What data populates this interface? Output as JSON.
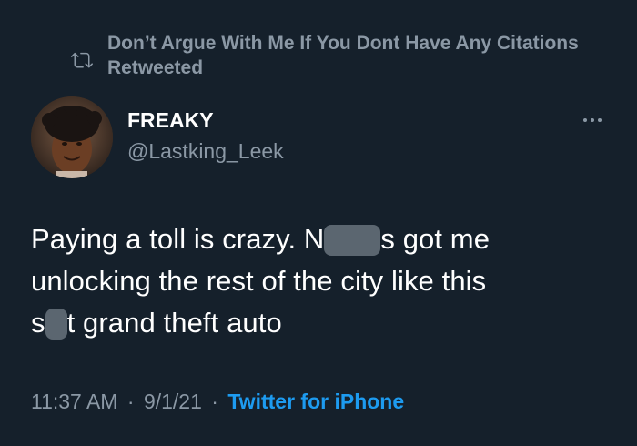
{
  "retweet": {
    "text": "Don’t Argue With Me If You Dont Have Any Citations Retweeted",
    "icon": "retweet-icon"
  },
  "author": {
    "display_name": "FREAKY",
    "handle": "@Lastking_Leek"
  },
  "tweet": {
    "line1_before": "Paying a toll is crazy. N",
    "line1_after": "s got me",
    "line2": "unlocking the rest of the city like this",
    "line3_before": "s",
    "line3_after": "t grand theft auto"
  },
  "meta": {
    "time": "11:37 AM",
    "separator": "·",
    "date": "9/1/21",
    "source": "Twitter for iPhone"
  },
  "colors": {
    "background": "#15202b",
    "primary_text": "#ffffff",
    "secondary_text": "#8b98a5",
    "link": "#1d9bf0",
    "divider": "#38444d"
  }
}
